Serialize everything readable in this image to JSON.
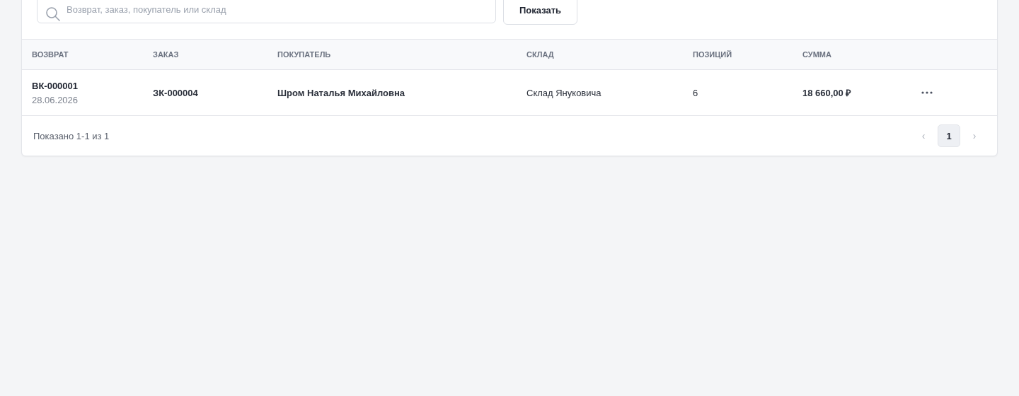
{
  "filters": {
    "search": {
      "placeholder": "Возврат, заказ, покупатель или склад"
    },
    "button": "Показать"
  },
  "table": {
    "columns": [
      "ВОЗВРАТ",
      "ЗАКАЗ",
      "ПОКУПАТЕЛЬ",
      "СКЛАД",
      "ПОЗИЦИЙ",
      "СУММА"
    ],
    "rows": [
      {
        "return_no": "ВК-000001",
        "date": "28.06.2026",
        "order": "ЗК-000004",
        "customer": "Шром Наталья Михайловна",
        "warehouse": "Склад Януковича",
        "items": "6",
        "total": "18 660,00 ₽"
      }
    ]
  },
  "footer": {
    "summary": "Показано 1-1 из 1",
    "pagination": {
      "prev": {
        "label": "‹",
        "disabled": true
      },
      "pages": [
        {
          "label": "1",
          "selected": true
        }
      ],
      "next": {
        "label": "›",
        "disabled": true
      }
    }
  }
}
